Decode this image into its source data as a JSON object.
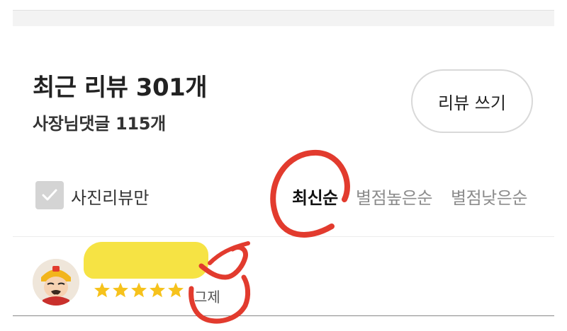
{
  "header": {
    "title": "최근 리뷰 301개",
    "owner_replies": "사장님댓글 115개",
    "write_review_label": "리뷰 쓰기"
  },
  "filters": {
    "photo_only_label": "사진리뷰만",
    "photo_only_checked": true,
    "sort_options": [
      "최신순",
      "별점높은순",
      "별점낮은순"
    ],
    "active_sort": "최신순"
  },
  "review": {
    "rating": 5,
    "tag": "그제"
  },
  "colors": {
    "star": "#f6c21c",
    "highlight": "#f6e23a",
    "annotation": "#e23b2e",
    "inactive_text": "#8c8c8c"
  },
  "icons": {
    "checkbox": "check-icon",
    "avatar": "avatar-icon",
    "star": "star-icon"
  }
}
